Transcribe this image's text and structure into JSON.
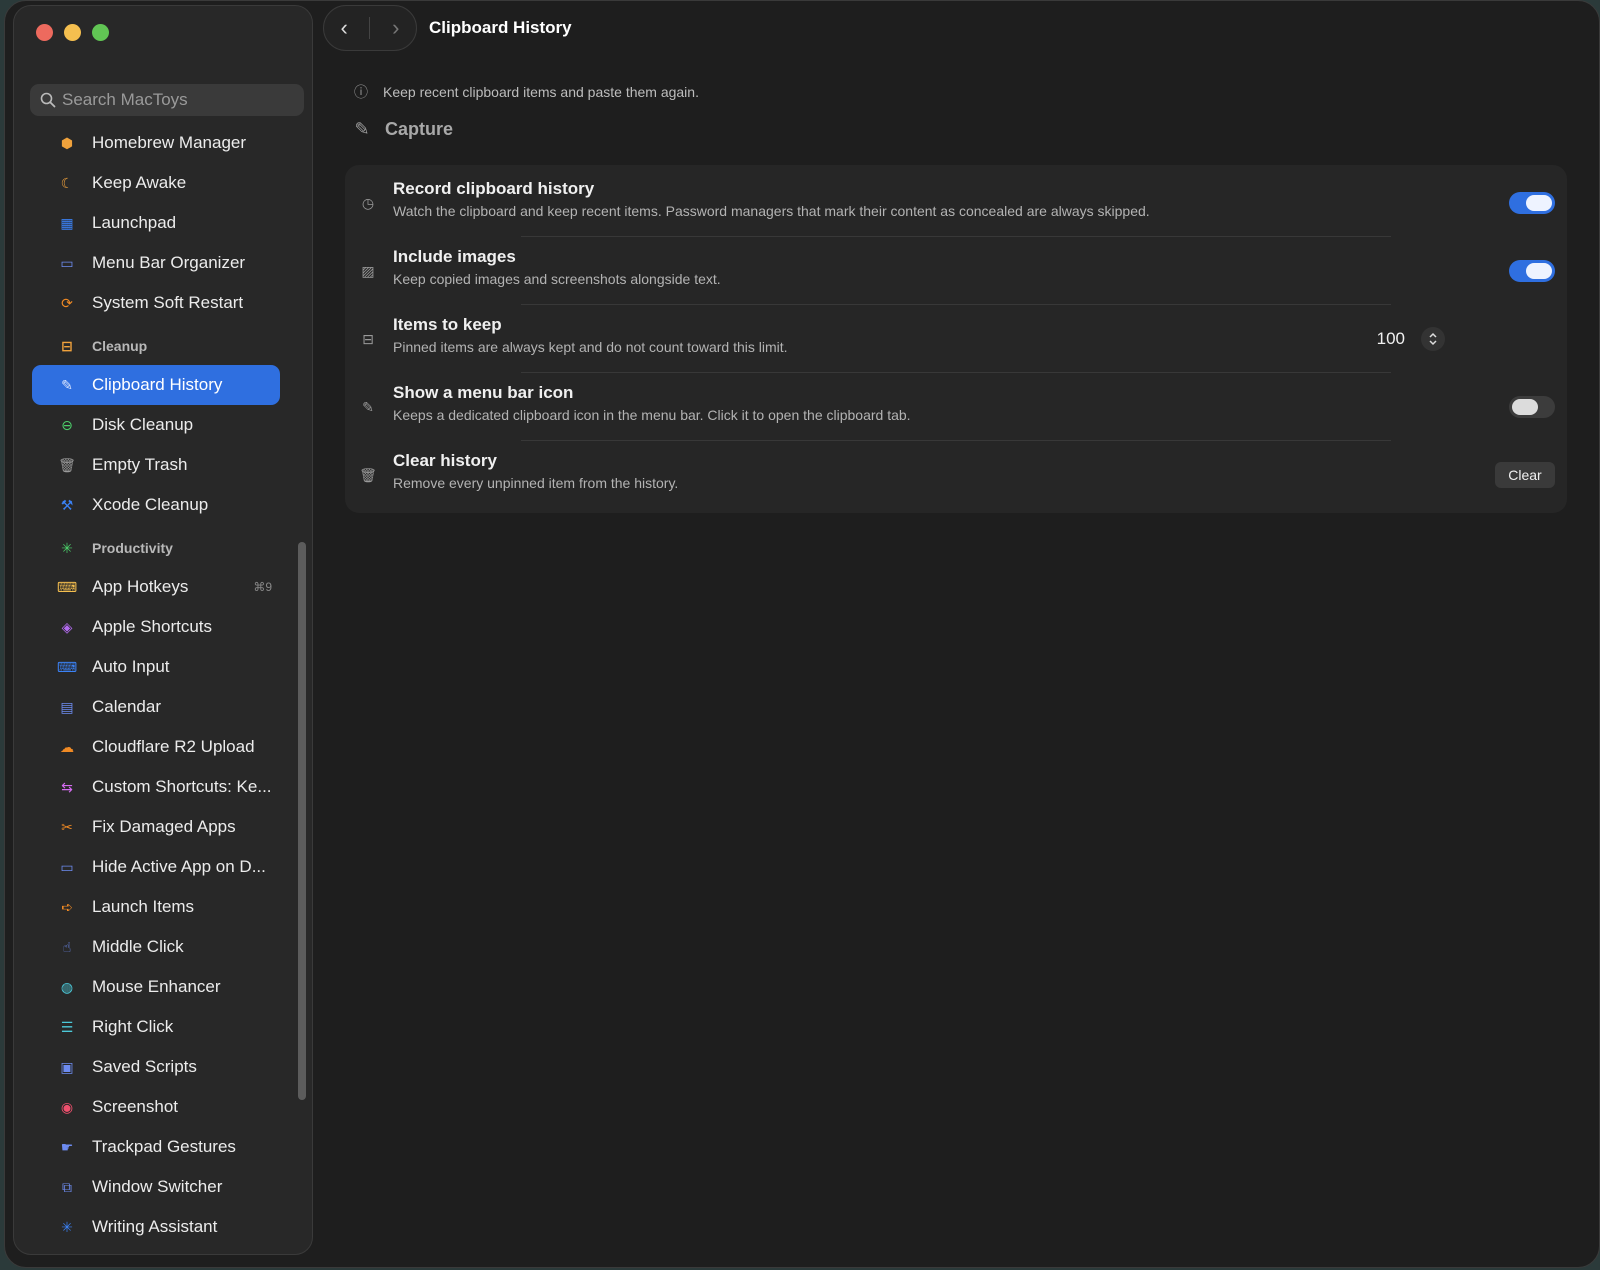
{
  "window": {
    "title": "Clipboard History"
  },
  "nav": {
    "back": "‹",
    "forward": "›"
  },
  "search": {
    "placeholder": "Search MacToys"
  },
  "sidebar": {
    "items": [
      {
        "label": "Homebrew Manager",
        "icon": "box-icon",
        "color": "#f0a23c"
      },
      {
        "label": "Keep Awake",
        "icon": "moon-icon",
        "color": "#f0a23c"
      },
      {
        "label": "Launchpad",
        "icon": "grid-icon",
        "color": "#3b82f6"
      },
      {
        "label": "Menu Bar Organizer",
        "icon": "window-icon",
        "color": "#6d8bf0"
      },
      {
        "label": "System Soft Restart",
        "icon": "restart-icon",
        "color": "#f08a24"
      }
    ],
    "cleanup": {
      "label": "Cleanup",
      "icon": "tray-icon",
      "color": "#f0a23c"
    },
    "cleanup_items": [
      {
        "label": "Clipboard History",
        "icon": "paperclip-icon",
        "color": "#9fc0ff",
        "active": true
      },
      {
        "label": "Disk Cleanup",
        "icon": "drive-icon",
        "color": "#4ccf6a"
      },
      {
        "label": "Empty Trash",
        "icon": "trash-icon",
        "color": "#9a9a9a"
      },
      {
        "label": "Xcode Cleanup",
        "icon": "hammer-icon",
        "color": "#3b82f6"
      }
    ],
    "productivity": {
      "label": "Productivity",
      "icon": "sparkle-icon",
      "color": "#4ccf6a"
    },
    "productivity_items": [
      {
        "label": "App Hotkeys",
        "icon": "keyboard-icon",
        "color": "#f5bf4f",
        "kbd": "⌘9"
      },
      {
        "label": "Apple Shortcuts",
        "icon": "layers-icon",
        "color": "#b36bf0"
      },
      {
        "label": "Auto Input",
        "icon": "keyboard-icon",
        "color": "#3b82f6"
      },
      {
        "label": "Calendar",
        "icon": "calendar-icon",
        "color": "#6d8bf0"
      },
      {
        "label": "Cloudflare R2 Upload",
        "icon": "cloud-icon",
        "color": "#f08a24"
      },
      {
        "label": "Custom Shortcuts: Ke...",
        "icon": "arrows-icon",
        "color": "#d46bf0"
      },
      {
        "label": "Fix Damaged Apps",
        "icon": "tools-icon",
        "color": "#f08a24"
      },
      {
        "label": "Hide Active App on D...",
        "icon": "display-icon",
        "color": "#6d8bf0"
      },
      {
        "label": "Launch Items",
        "icon": "launch-icon",
        "color": "#f08a24"
      },
      {
        "label": "Middle Click",
        "icon": "pointer-icon",
        "color": "#6d8bf0"
      },
      {
        "label": "Mouse Enhancer",
        "icon": "mouse-icon",
        "color": "#4cc9d9"
      },
      {
        "label": "Right Click",
        "icon": "menu-icon",
        "color": "#4cc9d9"
      },
      {
        "label": "Saved Scripts",
        "icon": "terminal-icon",
        "color": "#6d8bf0"
      },
      {
        "label": "Screenshot",
        "icon": "camera-icon",
        "color": "#f0506e"
      },
      {
        "label": "Trackpad Gestures",
        "icon": "gesture-icon",
        "color": "#6d8bf0"
      },
      {
        "label": "Window Switcher",
        "icon": "windows-icon",
        "color": "#6d8bf0"
      },
      {
        "label": "Writing Assistant",
        "icon": "sparkle-icon",
        "color": "#3b82f6"
      }
    ]
  },
  "main": {
    "info": "Keep recent clipboard items and paste them again.",
    "section": "Capture",
    "rows": [
      {
        "label": "Record clipboard history",
        "desc": "Watch the clipboard and keep recent items. Password managers that mark their content as concealed are always skipped.",
        "icon": "history-icon",
        "control": "toggle",
        "on": true
      },
      {
        "label": "Include images",
        "desc": "Keep copied images and screenshots alongside text.",
        "icon": "photo-icon",
        "control": "toggle",
        "on": true
      },
      {
        "label": "Items to keep",
        "desc": "Pinned items are always kept and do not count toward this limit.",
        "icon": "tray-icon",
        "control": "stepper",
        "value": "100"
      },
      {
        "label": "Show a menu bar icon",
        "desc": "Keeps a dedicated clipboard icon in the menu bar. Click it to open the clipboard tab.",
        "icon": "paperclip-icon",
        "control": "toggle",
        "on": false
      },
      {
        "label": "Clear history",
        "desc": "Remove every unpinned item from the history.",
        "icon": "trash-icon",
        "control": "button",
        "button": "Clear"
      }
    ]
  }
}
